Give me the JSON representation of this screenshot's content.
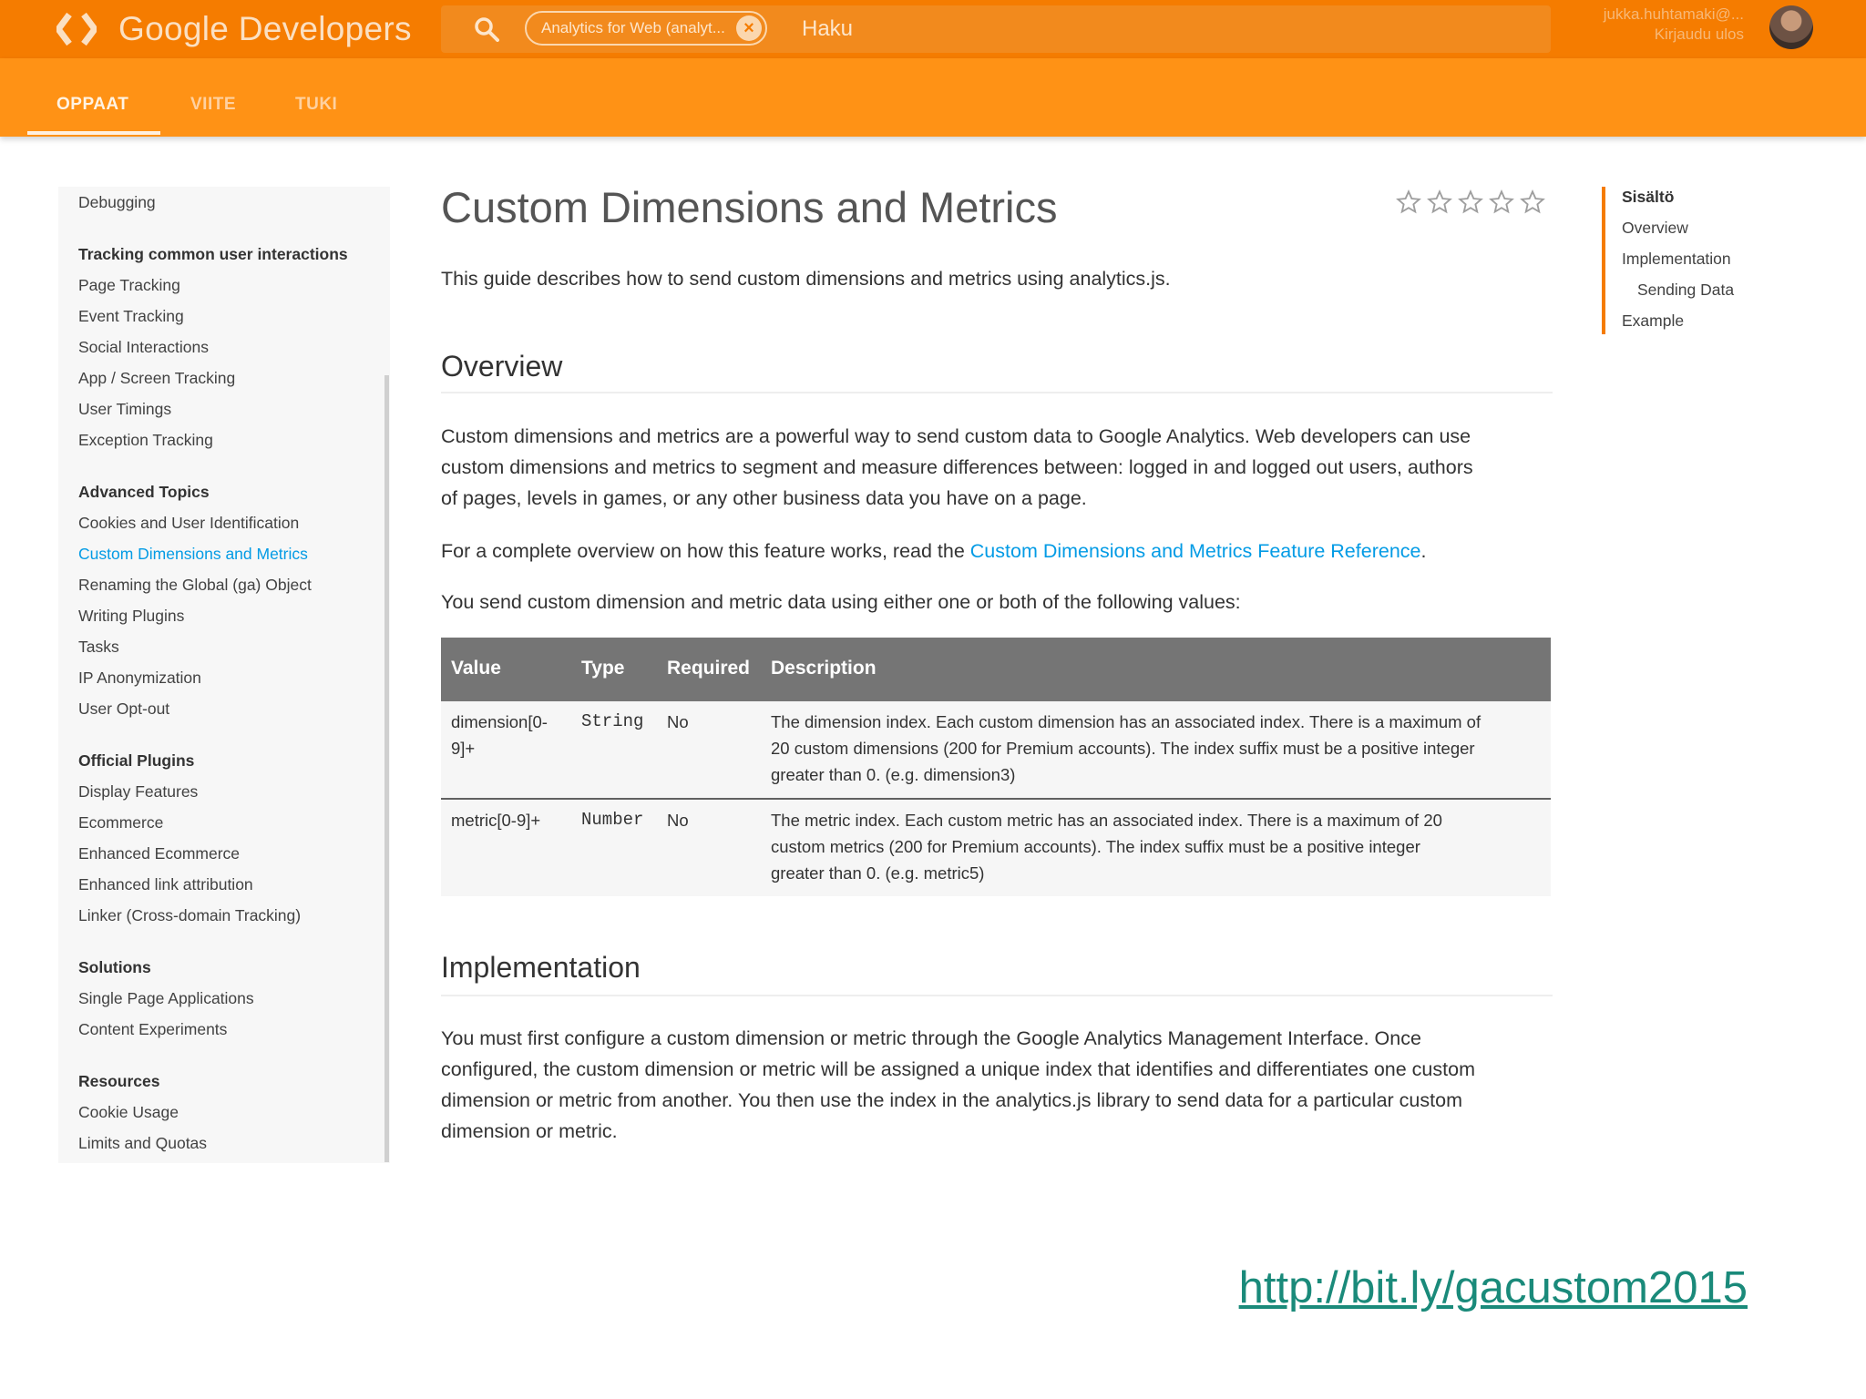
{
  "header": {
    "brand": "Google Developers",
    "search_chip": "Analytics for Web (analyt...",
    "search_label": "Haku",
    "user_email": "jukka.huhtamaki@...",
    "user_logout": "Kirjaudu ulos"
  },
  "nav": {
    "tabs": [
      {
        "label": "OPPAAT",
        "active": true
      },
      {
        "label": "VIITE",
        "active": false
      },
      {
        "label": "TUKI",
        "active": false
      }
    ]
  },
  "sidebar": {
    "items": [
      {
        "label": "Debugging",
        "type": "item"
      },
      {
        "label": "Tracking common user interactions",
        "type": "heading"
      },
      {
        "label": "Page Tracking",
        "type": "item"
      },
      {
        "label": "Event Tracking",
        "type": "item"
      },
      {
        "label": "Social Interactions",
        "type": "item"
      },
      {
        "label": "App / Screen Tracking",
        "type": "item"
      },
      {
        "label": "User Timings",
        "type": "item"
      },
      {
        "label": "Exception Tracking",
        "type": "item"
      },
      {
        "label": "Advanced Topics",
        "type": "heading"
      },
      {
        "label": "Cookies and User Identification",
        "type": "item"
      },
      {
        "label": "Custom Dimensions and Metrics",
        "type": "current"
      },
      {
        "label": "Renaming the Global (ga) Object",
        "type": "item"
      },
      {
        "label": "Writing Plugins",
        "type": "item"
      },
      {
        "label": "Tasks",
        "type": "item"
      },
      {
        "label": "IP Anonymization",
        "type": "item"
      },
      {
        "label": "User Opt-out",
        "type": "item"
      },
      {
        "label": "Official Plugins",
        "type": "heading"
      },
      {
        "label": "Display Features",
        "type": "item"
      },
      {
        "label": "Ecommerce",
        "type": "item"
      },
      {
        "label": "Enhanced Ecommerce",
        "type": "item"
      },
      {
        "label": "Enhanced link attribution",
        "type": "item"
      },
      {
        "label": "Linker (Cross-domain Tracking)",
        "type": "item"
      },
      {
        "label": "Solutions",
        "type": "heading"
      },
      {
        "label": "Single Page Applications",
        "type": "item"
      },
      {
        "label": "Content Experiments",
        "type": "item"
      },
      {
        "label": "Resources",
        "type": "heading"
      },
      {
        "label": "Cookie Usage",
        "type": "item"
      },
      {
        "label": "Limits and Quotas",
        "type": "item"
      }
    ]
  },
  "main": {
    "title": "Custom Dimensions and Metrics",
    "rating": {
      "filled": 0,
      "max": 5
    },
    "intro": "This guide describes how to send custom dimensions and metrics using analytics.js.",
    "overview_heading": "Overview",
    "overview_lines": [
      "Custom dimensions and metrics are a powerful way to send custom data to Google Analytics. Web developers can use",
      "custom dimensions and metrics to segment and measure differences between: logged in and logged out users, authors",
      "of pages, levels in games, or any other business data you have on a page."
    ],
    "reference_prefix": "For a complete overview on how this feature works, read the ",
    "reference_link": "Custom Dimensions and Metrics Feature Reference",
    "reference_suffix": ".",
    "values_intro": "You send custom dimension and metric data using either one or both of the following values:",
    "table": {
      "headers": [
        "Value",
        "Type",
        "Required",
        "Description"
      ],
      "rows": [
        {
          "value": [
            "dimension[0-",
            "9]+"
          ],
          "type": "String",
          "required": "No",
          "description": [
            "The dimension index. Each custom dimension has an associated index. There is a maximum of",
            "20 custom dimensions (200 for Premium accounts). The index suffix must be a positive integer",
            "greater than 0. (e.g. dimension3)"
          ]
        },
        {
          "value": [
            "metric[0-9]+"
          ],
          "type": "Number",
          "required": "No",
          "description": [
            "The metric index. Each custom metric has an associated index. There is a maximum of 20",
            "custom metrics (200 for Premium accounts). The index suffix must be a positive integer",
            "greater than 0. (e.g. metric5)"
          ]
        }
      ]
    },
    "implementation_heading": "Implementation",
    "implementation_lines": [
      "You must first configure a custom dimension or metric through the Google Analytics Management Interface. Once",
      "configured, the custom dimension or metric will be assigned a unique index that identifies and differentiates one custom",
      "dimension or metric from another. You then use the index in the analytics.js library to send data for a particular custom",
      "dimension or metric."
    ]
  },
  "toc": {
    "heading": "Sisältö",
    "items": [
      {
        "label": "Overview",
        "level": 1
      },
      {
        "label": "Implementation",
        "level": 1
      },
      {
        "label": "Sending Data",
        "level": 2
      },
      {
        "label": "Example",
        "level": 1
      }
    ]
  },
  "footer": {
    "url": "http://bit.ly/gacustom2015"
  },
  "colors": {
    "header": "#f57c00",
    "nav": "#ff9215",
    "link": "#039be5",
    "table_header": "#757575",
    "footer_link": "#1a8a7a"
  }
}
